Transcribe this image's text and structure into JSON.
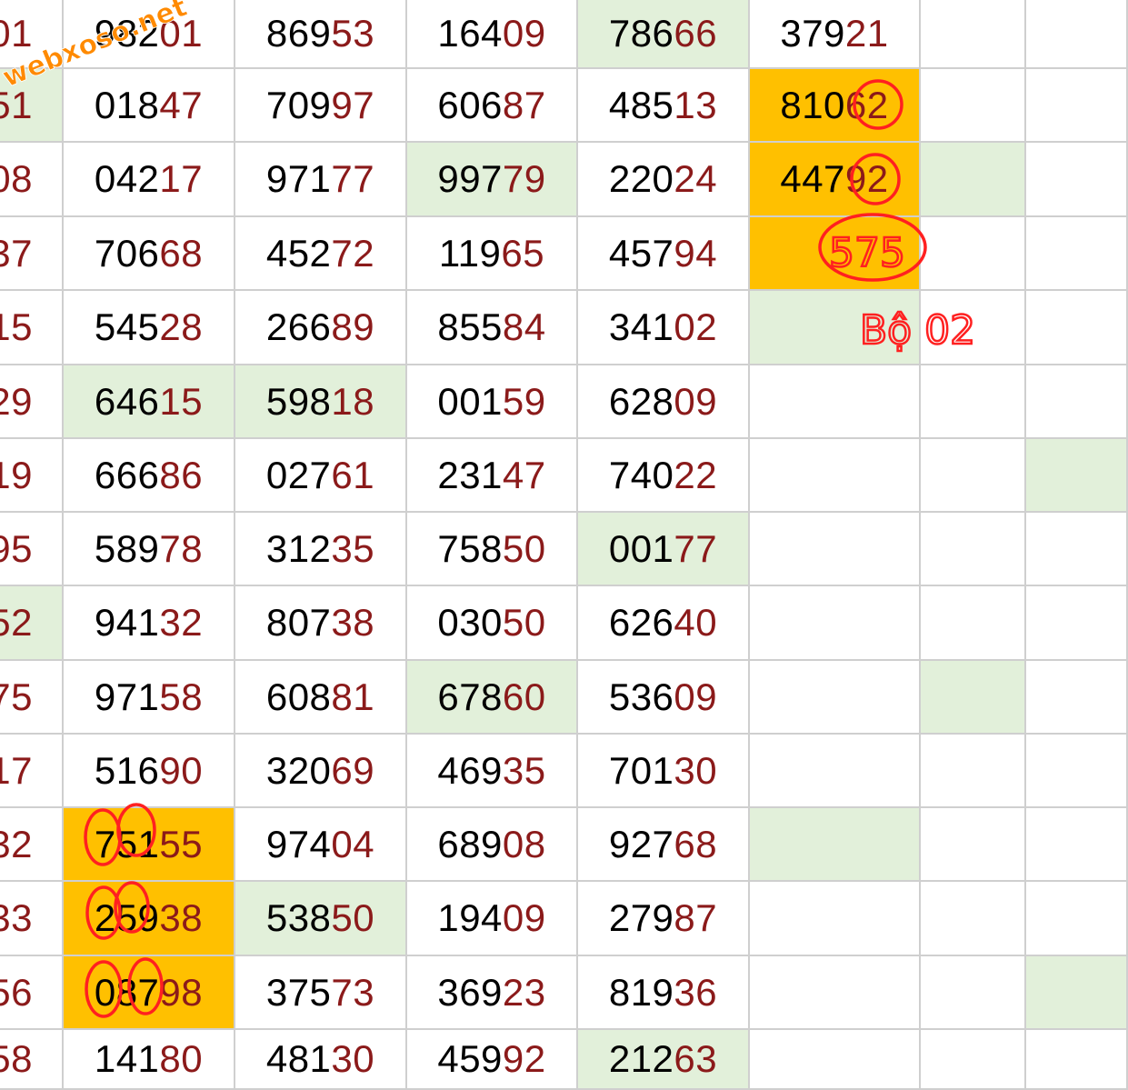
{
  "watermark": "webxoso.net",
  "colors": {
    "grid_line": "#cfcfcf",
    "highlight_green": "#e2f0da",
    "highlight_orange": "#ffc000",
    "tail_digits": "#8b1a1a",
    "annotation": "#ff2020"
  },
  "annotations": {
    "circled_number": "575",
    "note": "Bộ 02"
  },
  "rows": [
    [
      {
        "t": "01"
      },
      {
        "t": "98201"
      },
      {
        "t": "86953"
      },
      {
        "t": "16409"
      },
      {
        "t": "78666",
        "bg": "green"
      },
      {
        "t": "37921"
      },
      {
        "t": ""
      },
      {
        "t": ""
      }
    ],
    [
      {
        "t": "51",
        "bg": "green"
      },
      {
        "t": "01847"
      },
      {
        "t": "70997"
      },
      {
        "t": "60687"
      },
      {
        "t": "48513"
      },
      {
        "t": "81062",
        "bg": "orange"
      },
      {
        "t": ""
      },
      {
        "t": ""
      }
    ],
    [
      {
        "t": "08"
      },
      {
        "t": "04217"
      },
      {
        "t": "97177"
      },
      {
        "t": "99779",
        "bg": "green"
      },
      {
        "t": "22024"
      },
      {
        "t": "44792",
        "bg": "orange"
      },
      {
        "t": "",
        "bg": "green"
      },
      {
        "t": ""
      }
    ],
    [
      {
        "t": "37"
      },
      {
        "t": "70668"
      },
      {
        "t": "45272"
      },
      {
        "t": "11965"
      },
      {
        "t": "45794"
      },
      {
        "t": "",
        "bg": "orange"
      },
      {
        "t": ""
      },
      {
        "t": ""
      }
    ],
    [
      {
        "t": "15"
      },
      {
        "t": "54528"
      },
      {
        "t": "26689"
      },
      {
        "t": "85584"
      },
      {
        "t": "34102"
      },
      {
        "t": "",
        "bg": "green"
      },
      {
        "t": ""
      },
      {
        "t": ""
      }
    ],
    [
      {
        "t": "29"
      },
      {
        "t": "64615",
        "bg": "green"
      },
      {
        "t": "59818",
        "bg": "green"
      },
      {
        "t": "00159"
      },
      {
        "t": "62809"
      },
      {
        "t": ""
      },
      {
        "t": ""
      },
      {
        "t": ""
      }
    ],
    [
      {
        "t": "19"
      },
      {
        "t": "66686"
      },
      {
        "t": "02761"
      },
      {
        "t": "23147"
      },
      {
        "t": "74022"
      },
      {
        "t": ""
      },
      {
        "t": ""
      },
      {
        "t": "",
        "bg": "green"
      }
    ],
    [
      {
        "t": "95"
      },
      {
        "t": "58978"
      },
      {
        "t": "31235"
      },
      {
        "t": "75850"
      },
      {
        "t": "00177",
        "bg": "green"
      },
      {
        "t": ""
      },
      {
        "t": ""
      },
      {
        "t": ""
      }
    ],
    [
      {
        "t": "52",
        "bg": "green"
      },
      {
        "t": "94132"
      },
      {
        "t": "80738"
      },
      {
        "t": "03050"
      },
      {
        "t": "62640"
      },
      {
        "t": ""
      },
      {
        "t": ""
      },
      {
        "t": ""
      }
    ],
    [
      {
        "t": "75"
      },
      {
        "t": "97158"
      },
      {
        "t": "60881"
      },
      {
        "t": "67860",
        "bg": "green"
      },
      {
        "t": "53609"
      },
      {
        "t": ""
      },
      {
        "t": "",
        "bg": "green"
      },
      {
        "t": ""
      }
    ],
    [
      {
        "t": "17"
      },
      {
        "t": "51690"
      },
      {
        "t": "32069"
      },
      {
        "t": "46935"
      },
      {
        "t": "70130"
      },
      {
        "t": ""
      },
      {
        "t": ""
      },
      {
        "t": ""
      }
    ],
    [
      {
        "t": "32"
      },
      {
        "t": "75155",
        "bg": "orange"
      },
      {
        "t": "97404"
      },
      {
        "t": "68908"
      },
      {
        "t": "92768"
      },
      {
        "t": "",
        "bg": "green"
      },
      {
        "t": ""
      },
      {
        "t": ""
      }
    ],
    [
      {
        "t": "33"
      },
      {
        "t": "25938",
        "bg": "orange"
      },
      {
        "t": "53850",
        "bg": "green"
      },
      {
        "t": "19409"
      },
      {
        "t": "27987"
      },
      {
        "t": ""
      },
      {
        "t": ""
      },
      {
        "t": ""
      }
    ],
    [
      {
        "t": "56"
      },
      {
        "t": "08798",
        "bg": "orange"
      },
      {
        "t": "37573"
      },
      {
        "t": "36923"
      },
      {
        "t": "81936"
      },
      {
        "t": ""
      },
      {
        "t": ""
      },
      {
        "t": "",
        "bg": "green"
      }
    ],
    [
      {
        "t": "58"
      },
      {
        "t": "14180"
      },
      {
        "t": "48130"
      },
      {
        "t": "45992"
      },
      {
        "t": "21263",
        "bg": "green"
      },
      {
        "t": ""
      },
      {
        "t": ""
      },
      {
        "t": ""
      }
    ]
  ]
}
